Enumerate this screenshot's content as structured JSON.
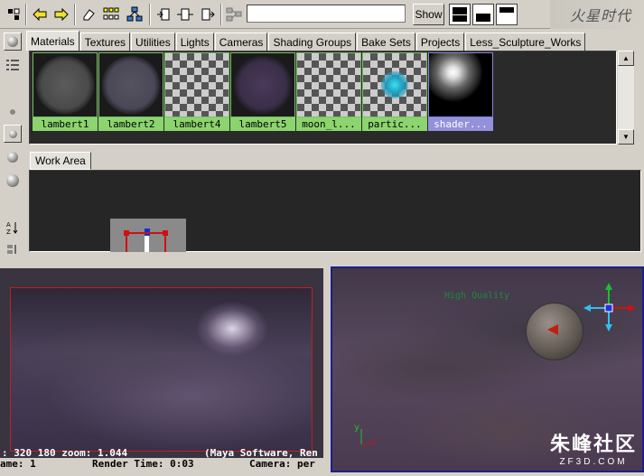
{
  "toolbar": {
    "search_value": "",
    "show_label": "Show",
    "logo_text": "火星时代"
  },
  "material_tabs": [
    {
      "label": "Materials"
    },
    {
      "label": "Textures"
    },
    {
      "label": "Utilities"
    },
    {
      "label": "Lights"
    },
    {
      "label": "Cameras"
    },
    {
      "label": "Shading Groups"
    },
    {
      "label": "Bake Sets"
    },
    {
      "label": "Projects"
    },
    {
      "label": "Less_Sculpture_Works"
    }
  ],
  "swatches": [
    {
      "label": "lambert1",
      "kind": "sphere-gray"
    },
    {
      "label": "lambert2",
      "kind": "sphere-slate"
    },
    {
      "label": "lambert4",
      "kind": "checker"
    },
    {
      "label": "lambert5",
      "kind": "sphere-purple"
    },
    {
      "label": "moon_l...",
      "kind": "checker"
    },
    {
      "label": "partic...",
      "kind": "checker-glow"
    },
    {
      "label": "shader...",
      "kind": "sphere-chrome",
      "selected": true
    }
  ],
  "work_area": {
    "tab_label": "Work Area"
  },
  "render_view": {
    "info_line": ": 320 180 zoom: 1.044",
    "renderer_line": "(Maya Software, Ren",
    "status": {
      "frame": "ame: 1",
      "render_time": "Render Time: 0:03",
      "camera": "Camera: per"
    }
  },
  "viewport": {
    "quality_label": "High Quality",
    "axis_y": "y",
    "axis_x": "x"
  },
  "watermark": {
    "line1": "朱峰社区",
    "line2": "ZF3D.COM"
  },
  "colors": {
    "swatch_label_bg": "#8cd46e",
    "swatch_selected_bg": "#9390dc",
    "render_frame_border": "#c02020",
    "viewport_border": "#1e1e8a"
  }
}
